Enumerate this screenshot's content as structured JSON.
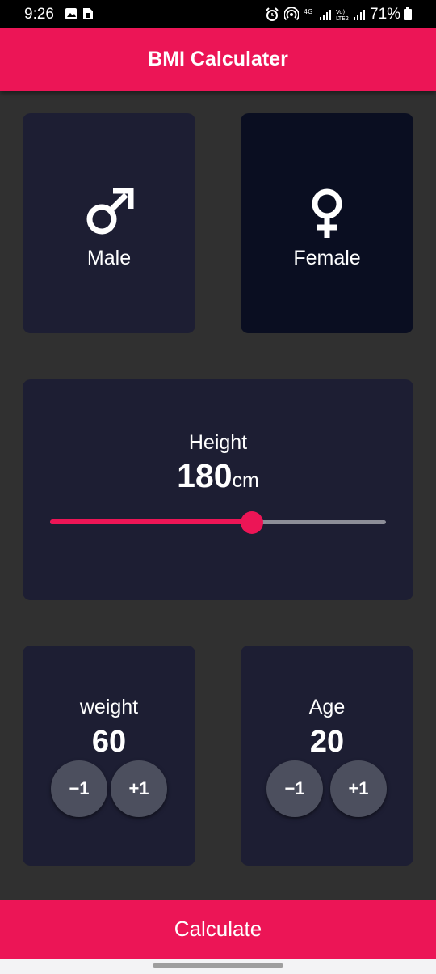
{
  "status_bar": {
    "time": "9:26",
    "battery_percent": "71%"
  },
  "app_bar": {
    "title": "BMI Calculater"
  },
  "gender": {
    "male_label": "Male",
    "female_label": "Female",
    "male_icon": "male-symbol-icon",
    "female_icon": "female-symbol-icon"
  },
  "height": {
    "label": "Height",
    "value": "180",
    "unit": "cm",
    "slider_fraction": 0.6
  },
  "weight": {
    "label": "weight",
    "value": "60",
    "minus_label": "−1",
    "plus_label": "+1"
  },
  "age": {
    "label": "Age",
    "value": "20",
    "minus_label": "−1",
    "plus_label": "+1"
  },
  "calculate_label": "Calculate",
  "colors": {
    "accent": "#EC1556",
    "card": "#1D1E33",
    "card_selected": "#0A0E21",
    "background": "#303030",
    "button": "#4C4F5E"
  }
}
